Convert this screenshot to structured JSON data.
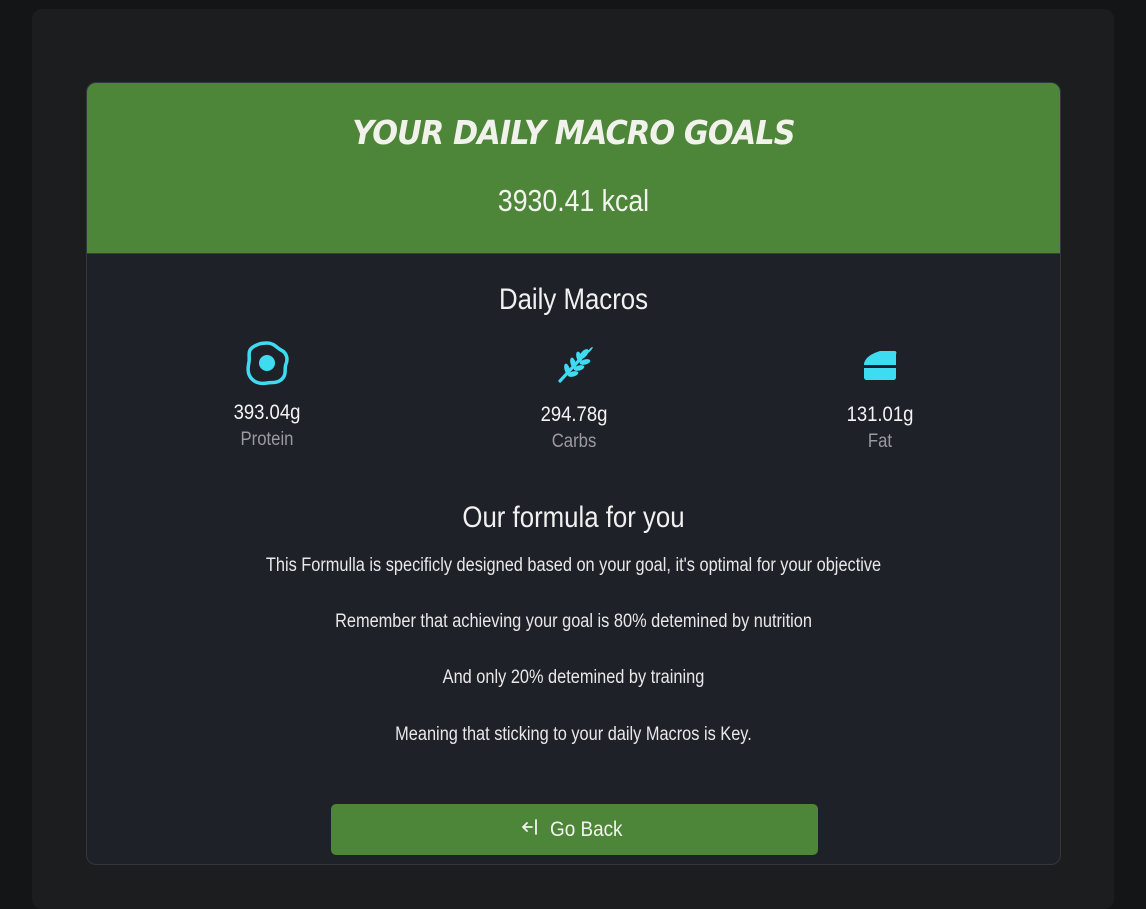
{
  "header": {
    "title": "YOUR DAILY MACRO GOALS",
    "calories": "3930.41 kcal"
  },
  "macros": {
    "section_title": "Daily Macros",
    "items": [
      {
        "icon": "egg-icon",
        "value": "393.04g",
        "label": "Protein"
      },
      {
        "icon": "wheat-icon",
        "value": "294.78g",
        "label": "Carbs"
      },
      {
        "icon": "cheese-icon",
        "value": "131.01g",
        "label": "Fat"
      }
    ]
  },
  "formula": {
    "section_title": "Our formula for you",
    "paragraphs": [
      "This Formulla is specificly designed based on your goal, it's optimal for your objective",
      "Remember that achieving your goal is 80% detemined by nutrition",
      "And only 20% detemined by training",
      "Meaning that sticking to your daily Macros is Key."
    ]
  },
  "actions": {
    "back_label": "Go Back",
    "back_icon": "arrow-left-to-line-icon"
  },
  "colors": {
    "accent_green": "#4d8539",
    "icon_cyan": "#3ddcf0",
    "card_bg": "#1f2129",
    "page_bg": "#141516"
  }
}
